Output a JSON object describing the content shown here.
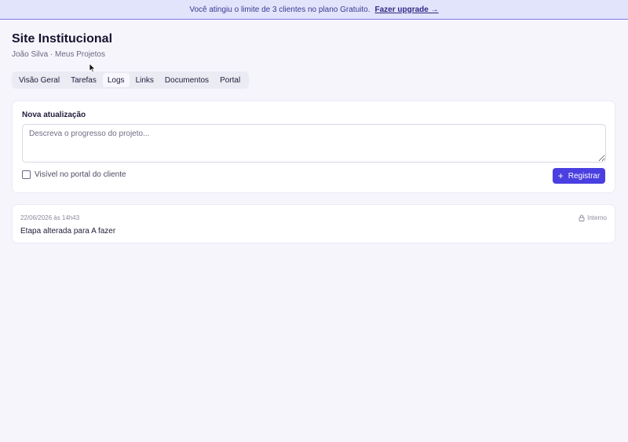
{
  "banner": {
    "message": "Você atingiu o limite de 3 clientes no plano Gratuito.",
    "link": "Fazer upgrade →"
  },
  "header": {
    "title": "Site Institucional",
    "breadcrumb": "João Silva · Meus Projetos"
  },
  "tabs": [
    {
      "label": "Visão Geral"
    },
    {
      "label": "Tarefas"
    },
    {
      "label": "Logs",
      "active": true
    },
    {
      "label": "Links"
    },
    {
      "label": "Documentos"
    },
    {
      "label": "Portal"
    }
  ],
  "update_form": {
    "label": "Nova atualização",
    "placeholder": "Descreva o progresso do projeto...",
    "value": "",
    "checkbox_label": "Visível no portal do cliente",
    "checkbox_checked": false,
    "submit_label": "Registrar",
    "submit_icon": "plus-icon"
  },
  "logs": [
    {
      "timestamp": "22/06/2026 às 14h43",
      "visibility": "Interno",
      "visibility_icon": "lock-icon",
      "text": "Etapa alterada para A fazer"
    }
  ],
  "colors": {
    "accent": "#4a3fe0",
    "banner_bg": "#e1e4fb",
    "page_bg": "#f6f5fc"
  }
}
